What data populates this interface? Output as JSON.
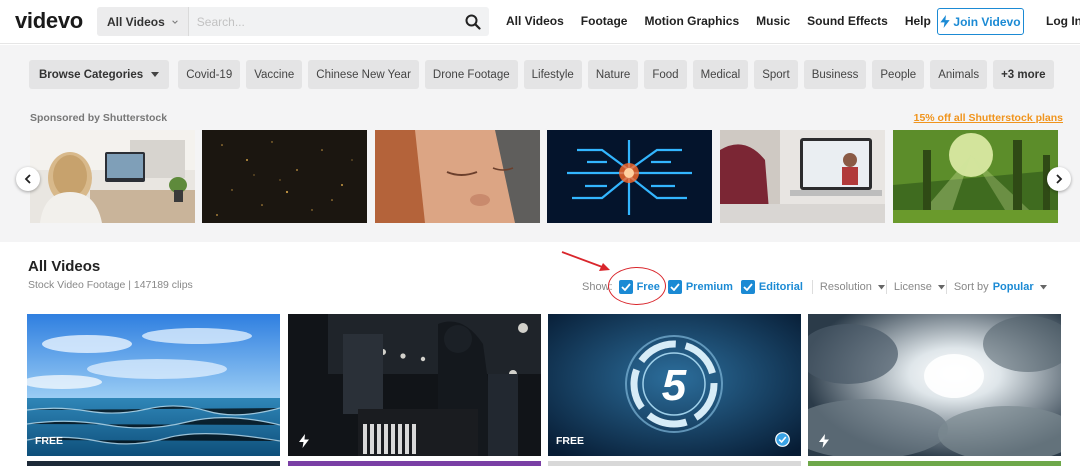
{
  "header": {
    "logo": "videvo",
    "search": {
      "scope": "All Videos",
      "placeholder": "Search..."
    },
    "nav": [
      "All Videos",
      "Footage",
      "Motion Graphics",
      "Music",
      "Sound Effects",
      "Help"
    ],
    "join_label": "Join Videvo",
    "login_label": "Log In"
  },
  "categories": {
    "browse_label": "Browse Categories",
    "chips": [
      "Covid-19",
      "Vaccine",
      "Chinese New Year",
      "Drone Footage",
      "Lifestyle",
      "Nature",
      "Food",
      "Medical",
      "Sport",
      "Business",
      "People",
      "Animals"
    ],
    "more_label": "+3 more"
  },
  "sponsored": {
    "label": "Sponsored by Shutterstock",
    "promo": "15% off all Shutterstock plans",
    "thumbnails": [
      "woman-video-call",
      "dark-particles",
      "woman-eyes-closed",
      "blue-circuit-glow",
      "man-laptop-call",
      "sunlit-forest"
    ]
  },
  "section": {
    "title": "All Videos",
    "subtitle": "Stock Video Footage | 147189 clips"
  },
  "filters": {
    "show_label": "Show:",
    "checks": [
      {
        "label": "Free",
        "checked": true
      },
      {
        "label": "Premium",
        "checked": true
      },
      {
        "label": "Editorial",
        "checked": true
      }
    ],
    "resolution_label": "Resolution",
    "license_label": "License",
    "sort_label": "Sort by",
    "sort_value": "Popular"
  },
  "videos": [
    {
      "subject": "ocean-waves-sky",
      "badge": "FREE",
      "icon": "none"
    },
    {
      "subject": "man-playing-piano-night",
      "badge": "",
      "icon": "bolt-icon"
    },
    {
      "subject": "countdown-number-5",
      "badge": "FREE",
      "icon": "check-circle-icon"
    },
    {
      "subject": "sun-through-clouds",
      "badge": "",
      "icon": "bolt-icon"
    }
  ],
  "colors": {
    "accent": "#1b8ad4",
    "promo": "#f0941d",
    "annotation": "#d9262c"
  }
}
